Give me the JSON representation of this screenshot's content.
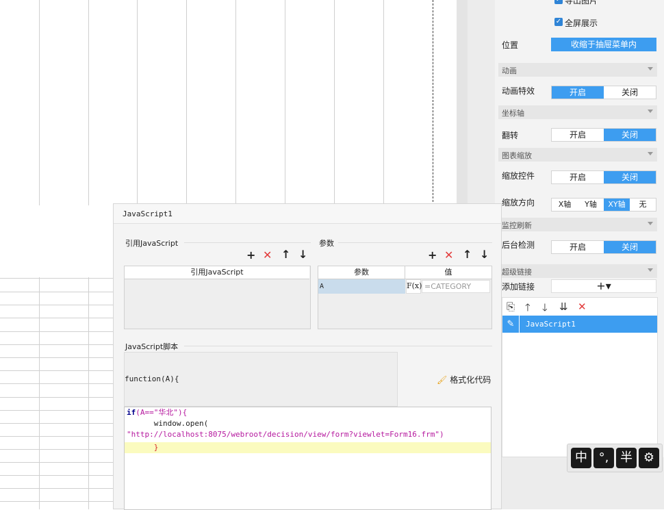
{
  "right_panel": {
    "export_image_label": "导出图片",
    "fullscreen_label": "全屏展示",
    "position_label": "位置",
    "position_value": "收缩于抽屉菜单内",
    "animation_section": "动画",
    "animation_effect_label": "动画特效",
    "axis_section": "坐标轴",
    "flip_label": "翻转",
    "zoom_section": "图表缩放",
    "zoom_control_label": "缩放控件",
    "zoom_direction_label": "缩放方向",
    "zoom_dir_x": "X轴",
    "zoom_dir_y": "Y轴",
    "zoom_dir_xy": "XY轴",
    "zoom_dir_none": "无",
    "refresh_section": "监控刷新",
    "background_check_label": "后台检测",
    "hyperlink_section": "超级链接",
    "add_link_label": "添加链接",
    "add_link_btn": "+▾",
    "on_label": "开启",
    "off_label": "关闭",
    "link_items": [
      "JavaScript1"
    ],
    "accent_color": "#3d9df0"
  },
  "dialog": {
    "title": "JavaScript1",
    "ref_js_group": "引用JavaScript",
    "params_group": "参数",
    "ref_js_column": "引用JavaScript",
    "param_column": "参数",
    "value_column": "值",
    "param_name": "A",
    "fx_label": "F(x)",
    "param_value": "=CATEGORY",
    "script_group": "JavaScript脚本",
    "function_header": "function(A){",
    "format_code_label": "格式化代码",
    "code": {
      "line1_kw": "if",
      "line1_rest_a": "(A==",
      "line1_str": "\"华北\"",
      "line1_rest_b": "){",
      "line2": "      window.open(",
      "line3": "\"http://localhost:8075/webroot/decision/view/form?viewlet=Form16.frm\")",
      "line4": "      }"
    }
  },
  "ime": {
    "key1": "中",
    "key2": "°,",
    "key3": "半",
    "key4": "⚙"
  }
}
